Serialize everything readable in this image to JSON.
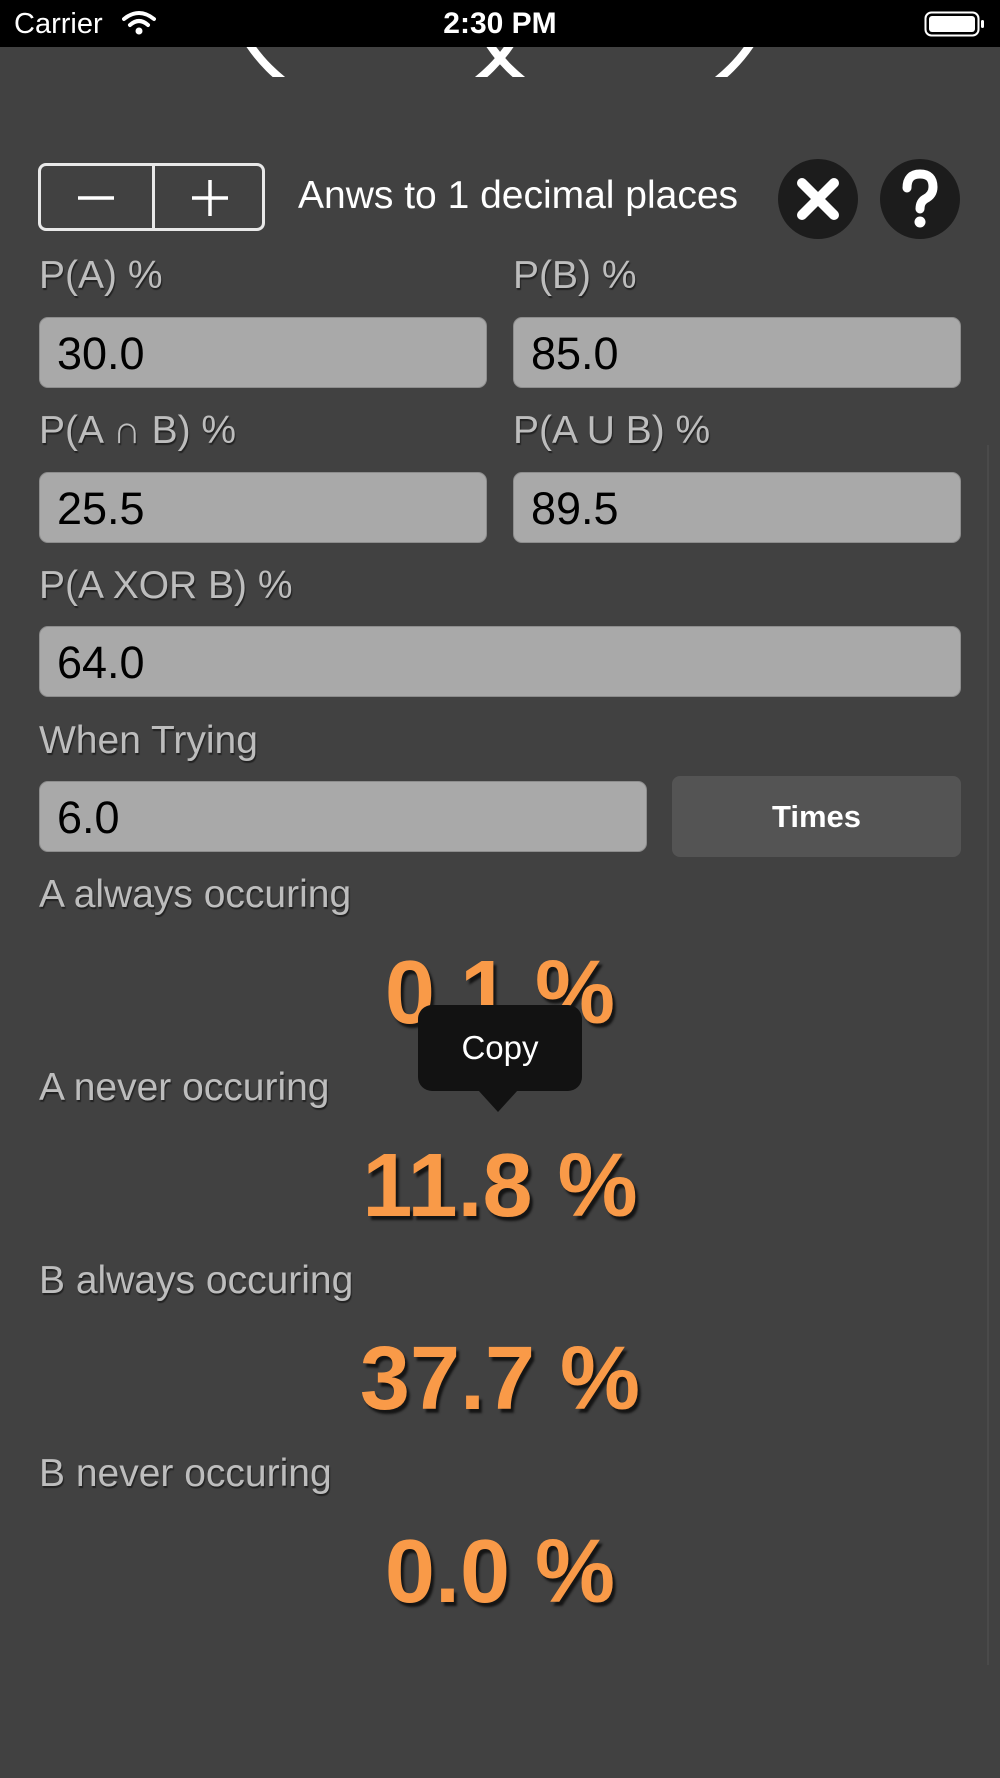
{
  "status_bar": {
    "carrier": "Carrier",
    "time": "2:30 PM"
  },
  "precision": {
    "label": "Anws to 1 decimal places"
  },
  "fields": {
    "p_a": {
      "label": "P(A) %",
      "value": "30.0"
    },
    "p_b": {
      "label": "P(B) %",
      "value": "85.0"
    },
    "p_a_and_b": {
      "label": "P(A ∩ B) %",
      "value": "25.5"
    },
    "p_a_or_b": {
      "label": "P(A U B) %",
      "value": "89.5"
    },
    "p_a_xor_b": {
      "label": "P(A XOR B) %",
      "value": "64.0"
    },
    "when_trying": {
      "label": "When Trying",
      "value": "6.0"
    }
  },
  "times_button": {
    "label": "Times"
  },
  "results": {
    "a_always": {
      "label": "A always occuring",
      "value": "0.1 %"
    },
    "a_never": {
      "label": "A never occuring",
      "value": "11.8 %"
    },
    "b_always": {
      "label": "B always occuring",
      "value": "37.7 %"
    },
    "b_never": {
      "label": "B never occuring",
      "value": "0.0 %"
    }
  },
  "copy_menu": {
    "label": "Copy"
  },
  "colors": {
    "background": "#414141",
    "result": "#f99a48",
    "field": "#a9a9a9",
    "button": "#545454"
  },
  "icons": {
    "wifi": "wifi-icon",
    "battery": "battery-icon",
    "stepper_minus": "minus-icon",
    "stepper_plus": "plus-icon",
    "clear": "close-icon",
    "help": "question-icon"
  }
}
